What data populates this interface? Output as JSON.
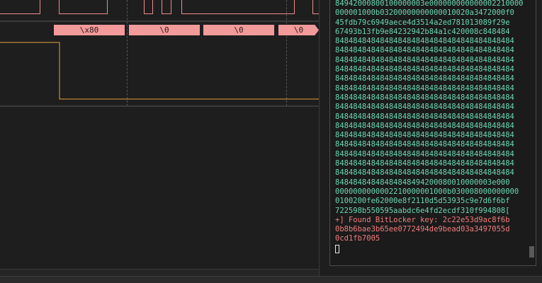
{
  "analyzer": {
    "decoded_bytes": [
      "\\x80",
      "\\0",
      "\\0",
      "\\0"
    ],
    "colors": {
      "clock": "#f08c8c",
      "byte_fill": "#f39a9a",
      "digital": "#e0a040",
      "grid": "#555555"
    }
  },
  "terminal": {
    "hex_lines": [
      "84942000800100000003e000000000000002210000",
      "000001000b03200000000000010020a3472000f0",
      "45fdb79c6949aece4d3514a2ed781013089f29e",
      "67493b13fb9e84232942b84a1c420008c848484",
      "8484848484848484848484848484848484848484",
      "8484848484848484848484848484848484848484",
      "8484848484848484848484848484848484848484",
      "8484848484848484848484848484848484848484",
      "8484848484848484848484848484848484848484",
      "8484848484848484848484848484848484848484",
      "8484848484848484848484848484848484848484",
      "8484848484848484848484848484848484848484",
      "8484848484848484848484848484848484848484",
      "8484848484848484848484848484848484848484",
      "8484848484848484848484848484848484848484",
      "8484848484848484848484848484848484848484",
      "8484848484848484848484848484848484848484",
      "8484848484848484848484848484848484848484",
      "8484848484848484848484848484848484848484",
      "84848484848484848494200080010000003e000",
      "0000000000002210000001000b030008000000000",
      "0100200fe62000e8f2110d5d53935c9e7d6f6bf",
      "722598b550595aabdc6e4fd2ecdf310f994808["
    ],
    "found_lines": [
      "+] Found BitLocker key: 2c22e53d9ac8f6b",
      "0b8b6bae3b65ee0772494de9bead03a3497055d",
      "0cd1fb7005"
    ],
    "colors": {
      "hex": "#6ad6b0",
      "found": "#f27c7c"
    }
  }
}
